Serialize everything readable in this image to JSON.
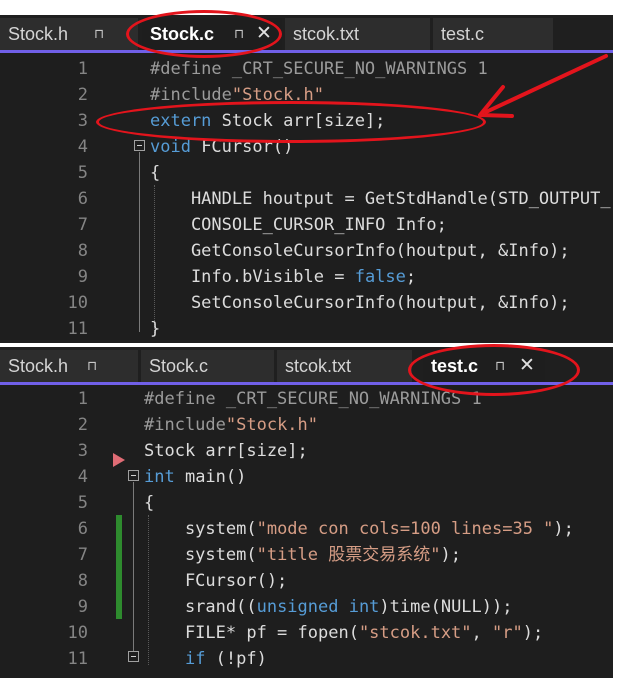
{
  "colors": {
    "accent": "#7160e8",
    "annotation": "#e3141c",
    "keyword": "#569cd6",
    "string": "#d69d85",
    "changed_marker": "#2e8b2e"
  },
  "pane_top": {
    "tabs": [
      {
        "label": "Stock.h",
        "pin": "⊓",
        "active": false
      },
      {
        "label": "Stock.c",
        "pin": "⊓",
        "close": "✕",
        "active": true
      },
      {
        "label": "stcok.txt",
        "active": false
      },
      {
        "label": "test.c",
        "active": false
      }
    ],
    "lines": [
      {
        "n": "1",
        "t": [
          {
            "c": "pp",
            "s": "#define _CRT_SECURE_NO_WARNINGS 1"
          }
        ]
      },
      {
        "n": "2",
        "t": [
          {
            "c": "pp",
            "s": "#include"
          },
          {
            "c": "str",
            "s": "\"Stock.h\""
          }
        ]
      },
      {
        "n": "3",
        "t": [
          {
            "c": "kw",
            "s": "extern"
          },
          {
            "s": " Stock arr[size];"
          }
        ]
      },
      {
        "n": "4",
        "t": [
          {
            "c": "kw",
            "s": "void"
          },
          {
            "s": " FCursor()"
          }
        ]
      },
      {
        "n": "5",
        "t": [
          {
            "s": "{"
          }
        ]
      },
      {
        "n": "6",
        "t": [
          {
            "s": "    HANDLE houtput = GetStdHandle(STD_OUTPUT_"
          }
        ]
      },
      {
        "n": "7",
        "t": [
          {
            "s": "    CONSOLE_CURSOR_INFO Info;"
          }
        ]
      },
      {
        "n": "8",
        "t": [
          {
            "s": "    GetConsoleCursorInfo(houtput, &Info);"
          }
        ]
      },
      {
        "n": "9",
        "t": [
          {
            "s": "    Info.bVisible = "
          },
          {
            "c": "kw",
            "s": "false"
          },
          {
            "s": ";"
          }
        ]
      },
      {
        "n": "10",
        "t": [
          {
            "s": "    SetConsoleCursorInfo(houtput, &Info);"
          }
        ]
      },
      {
        "n": "11",
        "t": [
          {
            "s": "}"
          }
        ]
      }
    ]
  },
  "pane_bottom": {
    "tabs": [
      {
        "label": "Stock.h",
        "pin": "⊓",
        "active": false
      },
      {
        "label": "Stock.c",
        "active": false
      },
      {
        "label": "stcok.txt",
        "active": false
      },
      {
        "label": "test.c",
        "pin": "⊓",
        "close": "✕",
        "active": true
      }
    ],
    "lines": [
      {
        "n": "1",
        "t": [
          {
            "c": "pp",
            "s": "#define _CRT_SECURE_NO_WARNINGS 1"
          }
        ]
      },
      {
        "n": "2",
        "t": [
          {
            "c": "pp",
            "s": "#include"
          },
          {
            "c": "str",
            "s": "\"Stock.h\""
          }
        ]
      },
      {
        "n": "3",
        "t": [
          {
            "s": "Stock arr[size];"
          }
        ]
      },
      {
        "n": "4",
        "t": [
          {
            "c": "kw",
            "s": "int"
          },
          {
            "s": " main()"
          }
        ]
      },
      {
        "n": "5",
        "t": [
          {
            "s": "{"
          }
        ]
      },
      {
        "n": "6",
        "t": [
          {
            "s": "    system("
          },
          {
            "c": "str",
            "s": "\"mode con cols=100 lines=35 \""
          },
          {
            "s": ");"
          }
        ]
      },
      {
        "n": "7",
        "t": [
          {
            "s": "    system("
          },
          {
            "c": "str",
            "s": "\"title 股票交易系统\""
          },
          {
            "s": ");"
          }
        ]
      },
      {
        "n": "8",
        "t": [
          {
            "s": "    FCursor();"
          }
        ]
      },
      {
        "n": "9",
        "t": [
          {
            "s": "    srand(("
          },
          {
            "c": "kw",
            "s": "unsigned int"
          },
          {
            "s": ")time(NULL));"
          }
        ]
      },
      {
        "n": "10",
        "t": [
          {
            "s": "    FILE* pf = fopen("
          },
          {
            "c": "str",
            "s": "\"stcok.txt\""
          },
          {
            "s": ", "
          },
          {
            "c": "str",
            "s": "\"r\""
          },
          {
            "s": ");"
          }
        ]
      },
      {
        "n": "11",
        "t": [
          {
            "s": "    "
          },
          {
            "c": "kw",
            "s": "if"
          },
          {
            "s": " (!pf)"
          }
        ]
      }
    ]
  }
}
